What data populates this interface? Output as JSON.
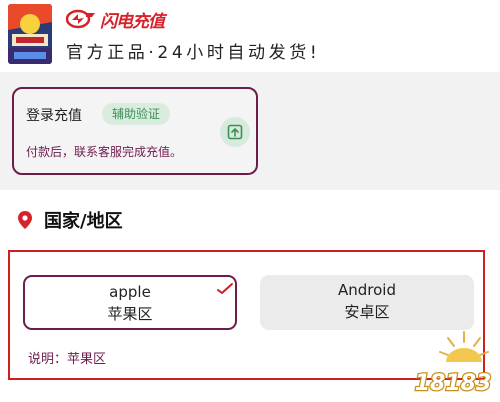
{
  "header": {
    "brand_name": "闪电充值",
    "tagline": "官方正品·24小时自动发货!"
  },
  "recharge": {
    "title": "登录充值",
    "badge": "辅助验证",
    "note": "付款后，联系客服完成充值。"
  },
  "region": {
    "title": "国家/地区",
    "options": [
      {
        "line1": "apple",
        "line2": "苹果区",
        "selected": true
      },
      {
        "line1": "Android",
        "line2": "安卓区",
        "selected": false
      }
    ],
    "note": "说明：苹果区"
  },
  "watermark": {
    "text": "18183"
  },
  "colors": {
    "brand_red": "#d8222a",
    "accent_purple": "#6e1c4d",
    "badge_green": "#3d8f58",
    "highlight_red": "#d01f1f"
  },
  "icons": [
    "game-cover-icon",
    "brand-logo-icon",
    "export-icon",
    "location-pin-icon",
    "checkmark-icon",
    "watermark-logo"
  ]
}
